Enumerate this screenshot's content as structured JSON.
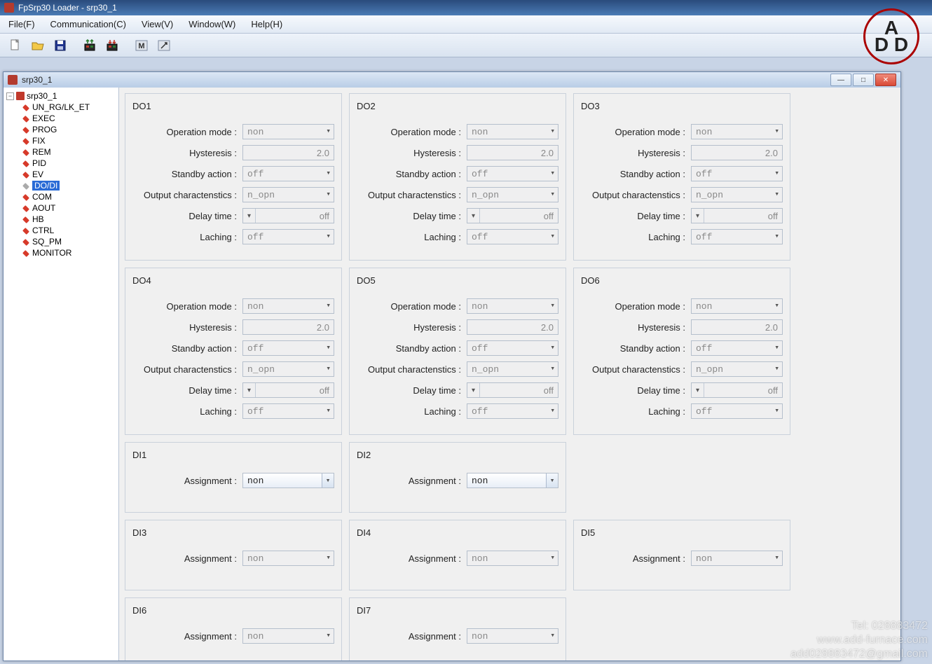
{
  "title": "FpSrp30 Loader - srp30_1",
  "menu": [
    "File(F)",
    "Communication(C)",
    "View(V)",
    "Window(W)",
    "Help(H)"
  ],
  "toolbar_icons": [
    "new-file-icon",
    "open-file-icon",
    "save-icon",
    "upload-device-icon",
    "download-device-icon",
    "monitor-m-icon",
    "arrow-tool-icon"
  ],
  "child_title": "srp30_1",
  "tree_root": "srp30_1",
  "tree_nodes": [
    {
      "label": "UN_RG/LK_ET",
      "selected": false
    },
    {
      "label": "EXEC",
      "selected": false
    },
    {
      "label": "PROG",
      "selected": false
    },
    {
      "label": "FIX",
      "selected": false
    },
    {
      "label": "REM",
      "selected": false
    },
    {
      "label": "PID",
      "selected": false
    },
    {
      "label": "EV",
      "selected": false
    },
    {
      "label": "DO/DI",
      "selected": true,
      "eye": true
    },
    {
      "label": "COM",
      "selected": false
    },
    {
      "label": "AOUT",
      "selected": false
    },
    {
      "label": "HB",
      "selected": false
    },
    {
      "label": "CTRL",
      "selected": false
    },
    {
      "label": "SQ_PM",
      "selected": false
    },
    {
      "label": "MONITOR",
      "selected": false
    }
  ],
  "field_labels": {
    "op_mode": "Operation mode :",
    "hyst": "Hysteresis :",
    "standby": "Standby action :",
    "outchar": "Output charactenstics :",
    "delay": "Delay time :",
    "laching": "Laching :",
    "assign": "Assignment :"
  },
  "do_groups": [
    {
      "title": "DO1"
    },
    {
      "title": "DO2"
    },
    {
      "title": "DO3"
    },
    {
      "title": "DO4"
    },
    {
      "title": "DO5"
    },
    {
      "title": "DO6"
    }
  ],
  "do_values": {
    "op_mode": "non",
    "hyst": "2.0",
    "standby": "off",
    "outchar": "n_opn",
    "delay": "off",
    "laching": "off"
  },
  "di_groups": [
    {
      "title": "DI1",
      "active": true
    },
    {
      "title": "DI2",
      "active": true
    },
    {
      "title": "DI3",
      "active": false
    },
    {
      "title": "DI4",
      "active": false
    },
    {
      "title": "DI5",
      "active": false
    },
    {
      "title": "DI6",
      "active": false
    },
    {
      "title": "DI7",
      "active": false
    }
  ],
  "di_value": "non",
  "watermark": {
    "line1": "Tel: 028883472",
    "line2": "www.add-furnace.com",
    "line3": "add028883472@gmail.com"
  }
}
